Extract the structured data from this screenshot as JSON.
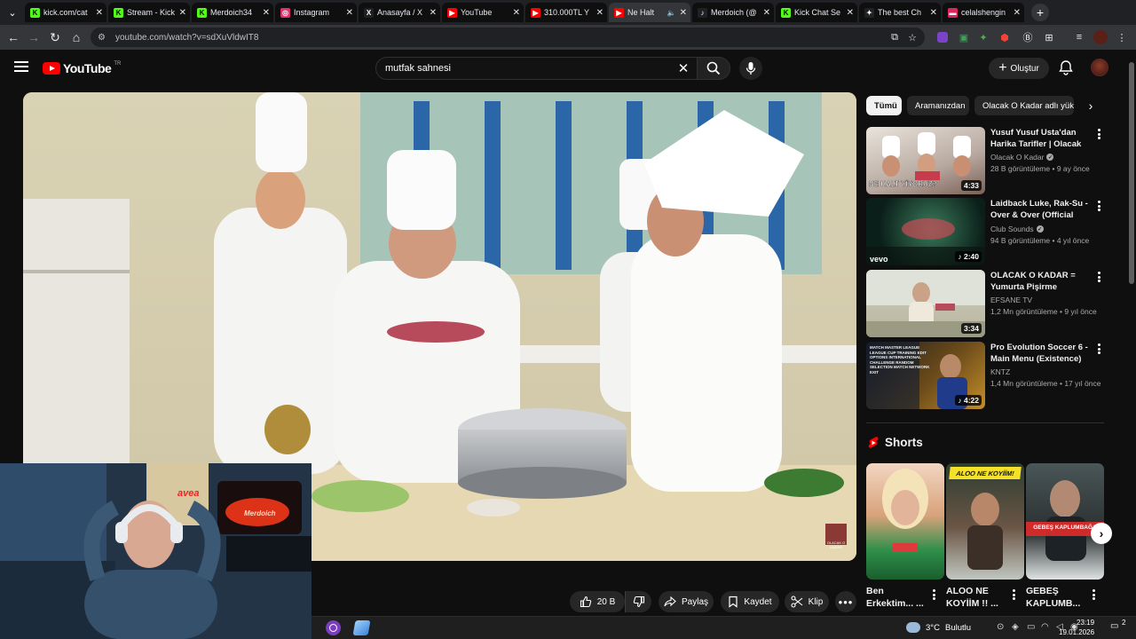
{
  "browser": {
    "tabs": [
      {
        "title": "kick.com/cat",
        "fav_color": "#53fc18",
        "fav_glyph": "K"
      },
      {
        "title": "Stream - Kick",
        "fav_color": "#53fc18",
        "fav_glyph": "K"
      },
      {
        "title": "Merdoich34",
        "fav_color": "#53fc18",
        "fav_glyph": "K"
      },
      {
        "title": "Instagram",
        "fav_color": "#e1306c",
        "fav_glyph": "◎"
      },
      {
        "title": "Anasayfa / X",
        "fav_color": "#ffffff",
        "fav_glyph": "X"
      },
      {
        "title": "YouTube",
        "fav_color": "#ff0000",
        "fav_glyph": "▶"
      },
      {
        "title": "310.000TL Y",
        "fav_color": "#ff0000",
        "fav_glyph": "▶"
      },
      {
        "title": "Ne Halt",
        "fav_color": "#ff0000",
        "fav_glyph": "▶"
      },
      {
        "title": "Merdoich (@",
        "fav_color": "#ffffff",
        "fav_glyph": "♪"
      },
      {
        "title": "Kick Chat Se",
        "fav_color": "#53fc18",
        "fav_glyph": "K"
      },
      {
        "title": "The best Ch",
        "fav_color": "#ffffff",
        "fav_glyph": "✦"
      },
      {
        "title": "celalshengin",
        "fav_color": "#e0245e",
        "fav_glyph": "▬"
      }
    ],
    "url": "youtube.com/watch?v=sdXuVldwIT8"
  },
  "youtube": {
    "logo_text": "YouTube",
    "country_code": "TR",
    "search_value": "mutfak sahnesi",
    "create_label": "Oluştur"
  },
  "actions": {
    "like_count": "20 B",
    "share_label": "Paylaş",
    "save_label": "Kaydet",
    "clip_label": "Klip"
  },
  "sidebar": {
    "chips": [
      "Tümü",
      "Aramanızdan",
      "Olacak O Kadar adlı yükleyiciden"
    ],
    "videos": [
      {
        "title": "Yusuf Yusuf Usta'dan Harika Tarifler | Olacak O ...",
        "channel": "Olacak O Kadar",
        "verified": true,
        "views": "28 B görüntüleme",
        "age": "9 ay önce",
        "duration": "4:33",
        "thumb_text": "NE HALT YİYORUZ?"
      },
      {
        "title": "Laidback Luke, Rak-Su - Over & Over (Official Mus...",
        "channel": "Club Sounds",
        "verified": true,
        "views": "94 B görüntüleme",
        "age": "4 yıl önce",
        "duration": "2:40",
        "thumb_text": "vevo"
      },
      {
        "title": "OLACAK O KADAR = Yumurta Pişirme Yöntem...",
        "channel": "EFSANE TV",
        "verified": false,
        "views": "1,2 Mn görüntüleme",
        "age": "9 yıl önce",
        "duration": "3:34",
        "thumb_text": ""
      },
      {
        "title": "Pro Evolution Soccer 6 - Main Menu (Existence) ...",
        "channel": "KNTZ",
        "verified": false,
        "views": "1,4 Mn görüntüleme",
        "age": "17 yıl önce",
        "duration": "4:22",
        "thumb_text": "MATCH MASTER LEAGUE LEAGUE CUP TRAINING EDIT OPTIONS INTERNATIONAL CHALLENGE RANDOM SELECTION MATCH NETWORK EXIT"
      }
    ],
    "shorts_heading": "Shorts",
    "shorts": [
      {
        "title": "Ben Erkektim... ...",
        "overlay": ""
      },
      {
        "title": "ALOO NE KOYİİM !! ...",
        "overlay": "ALOO NE KOYİİM!"
      },
      {
        "title": "GEBEŞ KAPLUMB...",
        "overlay": "GEBEŞ KAPLUMBAĞA"
      }
    ]
  },
  "player": {
    "watermark": "OLACAK O KADAR"
  },
  "webcam": {
    "sign_text": "Merdoich",
    "brand_text": "avea"
  },
  "taskbar": {
    "temperature": "3°C",
    "weather": "Bulutlu",
    "time": "23:19",
    "date": "19.01.2026",
    "notification_count": "2"
  },
  "colors": {
    "yt_red": "#ff0000",
    "bg": "#0f0f0f",
    "chip_bg": "#272727",
    "secondary_text": "#aaaaaa"
  }
}
